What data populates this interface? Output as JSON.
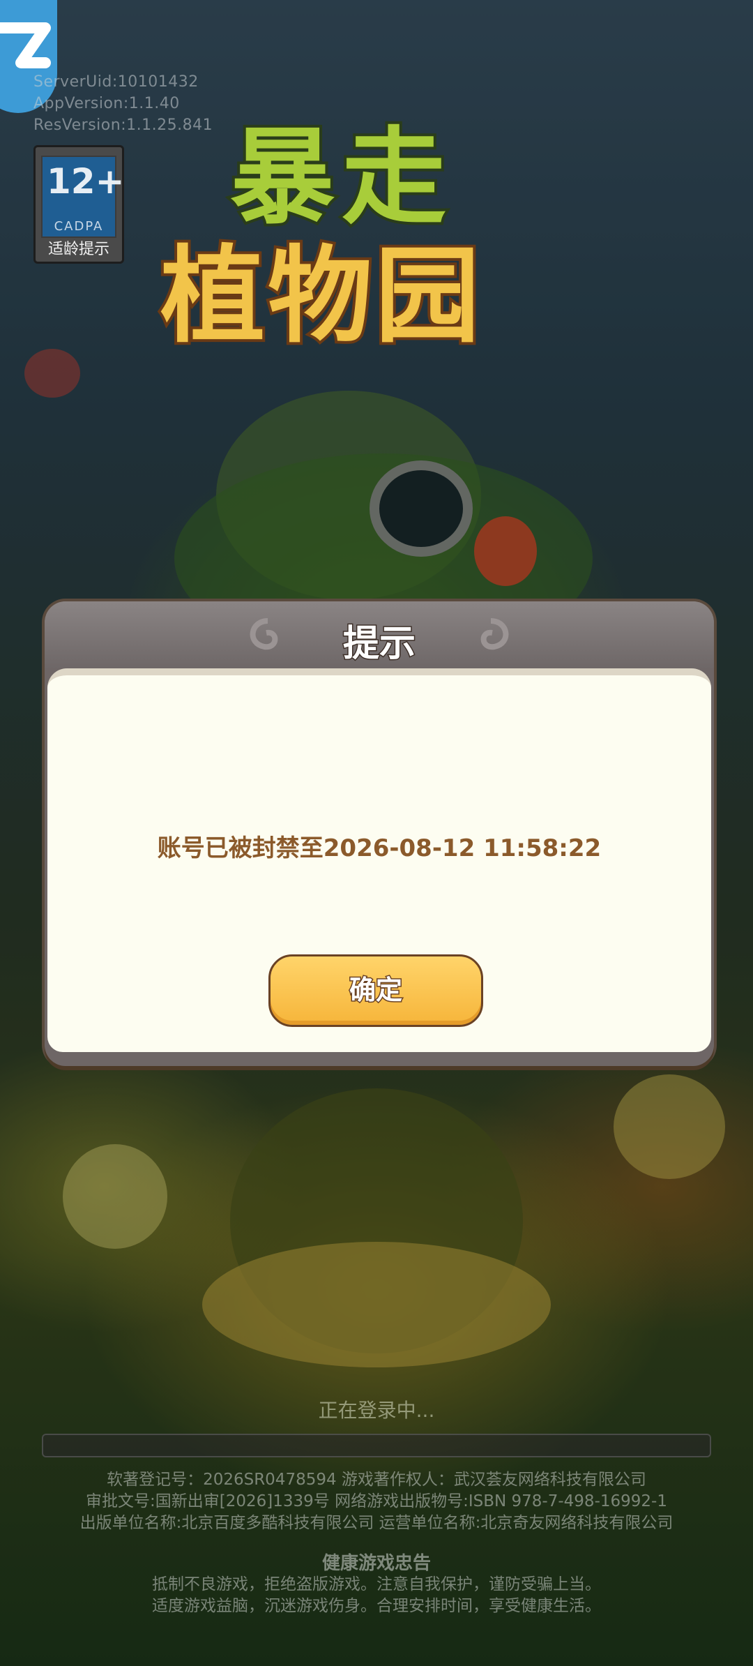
{
  "debug_info": {
    "server_uid": "ServerUid:10101432",
    "app_version": "AppVersion:1.1.40",
    "res_version": "ResVersion:1.1.25.841"
  },
  "age_rating": {
    "number": "12+",
    "org": "CADPA",
    "label": "适龄提示"
  },
  "logo": {
    "line1": "暴走",
    "line2": "植物园"
  },
  "dialog": {
    "title": "提示",
    "message": "账号已被封禁至2026-08-12 11:58:22",
    "confirm_label": "确定"
  },
  "loading": {
    "status": "正在登录中...",
    "progress": 0
  },
  "legal": {
    "line1": "软著登记号：2026SR0478594  游戏著作权人：武汉荟友网络科技有限公司",
    "line2": "审批文号:国新出审[2026]1339号  网络游戏出版物号:ISBN 978-7-498-16992-1",
    "line3": "出版单位名称:北京百度多酷科技有限公司  运营单位名称:北京奇友网络科技有限公司"
  },
  "health_advice": {
    "title": "健康游戏忠告",
    "line1": "抵制不良游戏，拒绝盗版游戏。注意自我保护，谨防受骗上当。",
    "line2": "适度游戏益脑，沉迷游戏伤身。合理安排时间，享受健康生活。"
  },
  "colors": {
    "dialog_text": "#8b5a2b",
    "button_fill": "#f6b53a",
    "dialog_body": "#fdfdf1"
  }
}
